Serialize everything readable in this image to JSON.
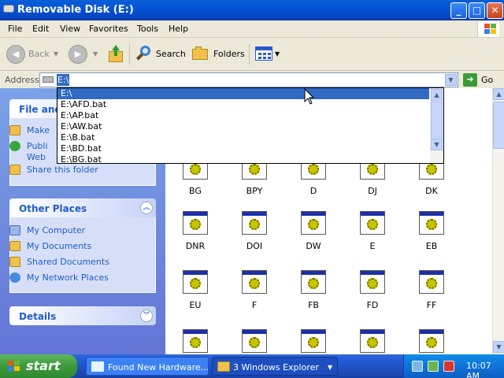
{
  "window": {
    "title": "Removable Disk (E:)",
    "buttons": {
      "minimize": "_",
      "maximize": "□",
      "close": "✕"
    }
  },
  "menu": [
    "File",
    "Edit",
    "View",
    "Favorites",
    "Tools",
    "Help"
  ],
  "toolbar": {
    "back": "Back",
    "search": "Search",
    "folders": "Folders"
  },
  "address": {
    "label": "Address",
    "value": "E:\\",
    "go": "Go"
  },
  "autocomplete": {
    "items": [
      "E:\\",
      "E:\\AFD.bat",
      "E:\\AP.bat",
      "E:\\AW.bat",
      "E:\\B.bat",
      "E:\\BD.bat",
      "E:\\BG.bat"
    ],
    "selected_index": 0
  },
  "tasks_pane": {
    "file_folder": {
      "title": "File and",
      "items": [
        "Make",
        "Publi",
        "Web",
        "Share this folder"
      ]
    },
    "other_places": {
      "title": "Other Places",
      "items": [
        "My Computer",
        "My Documents",
        "Shared Documents",
        "My Network Places"
      ]
    },
    "details": {
      "title": "Details"
    }
  },
  "files": {
    "row1": [
      "BG",
      "BPY",
      "D",
      "DJ",
      "DK"
    ],
    "row2": [
      "DNR",
      "DOI",
      "DW",
      "E",
      "EB"
    ],
    "row3": [
      "EU",
      "F",
      "FB",
      "FD",
      "FF"
    ],
    "row4": [
      "",
      "",
      "",
      "",
      ""
    ]
  },
  "taskbar": {
    "start": "start",
    "tasks": [
      "Found New Hardware...",
      "3 Windows Explorer"
    ],
    "clock": "10:07 AM"
  },
  "colors": {
    "titlebar": "#0454d8",
    "selection": "#316ac5",
    "taskpane_link": "#215dc6",
    "start_green": "#3c9a3c"
  }
}
